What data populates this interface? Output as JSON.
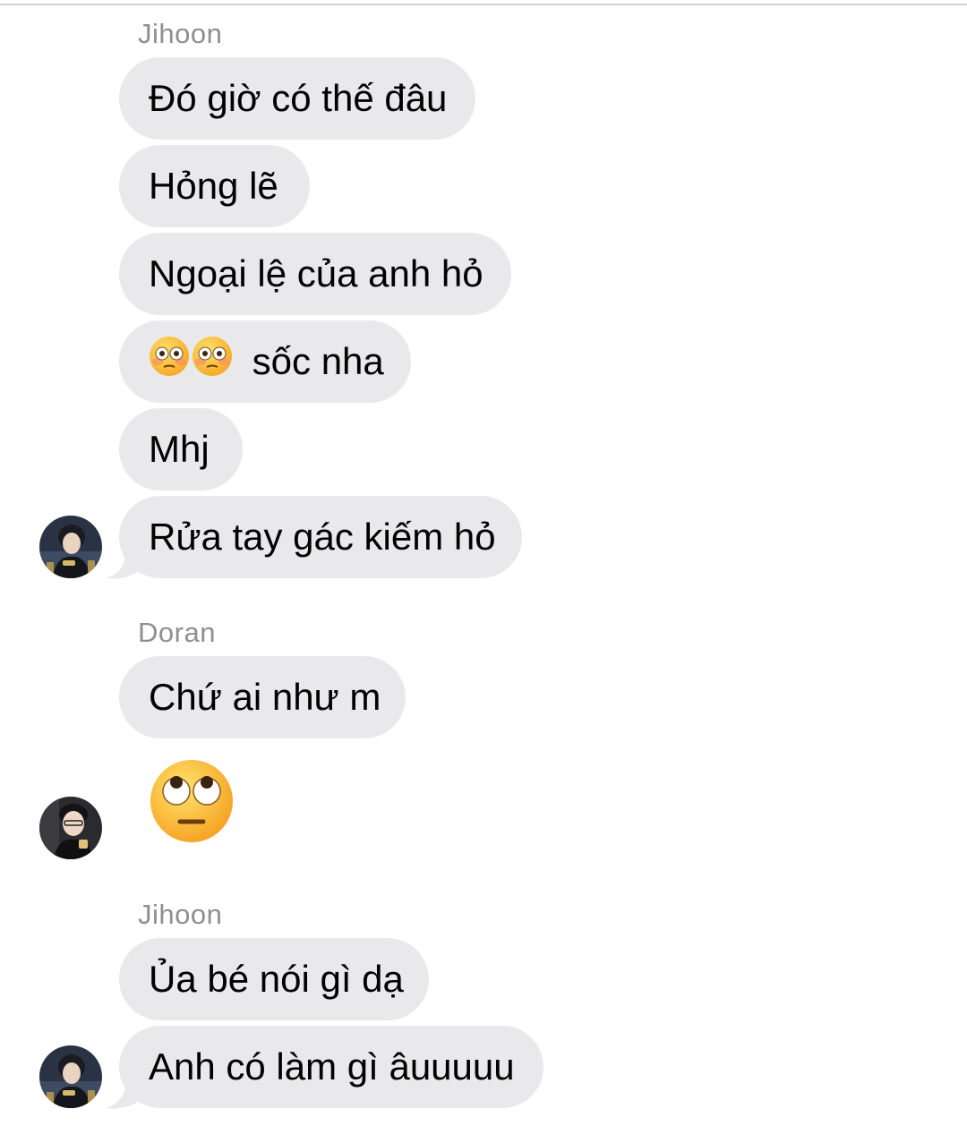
{
  "groups": [
    {
      "sender": "Jihoon",
      "messages": [
        "Đó giờ có thế đâu",
        "Hỏng lẽ",
        "Ngoại lệ của anh hỏ",
        "sốc nha",
        "Mhj",
        "Rửa tay gác kiếm hỏ"
      ]
    },
    {
      "sender": "Doran",
      "messages": [
        "Chứ ai như m"
      ],
      "emoji_message": "face-with-rolling-eyes"
    },
    {
      "sender": "Jihoon",
      "messages": [
        "Ủa bé nói gì dạ",
        "Anh có làm gì âuuuuu"
      ]
    }
  ],
  "emoji_prefix": [
    "flushed-face",
    "flushed-face"
  ],
  "colors": {
    "bubble": "#e9e9eb",
    "sender_name": "#8e8e93",
    "text": "#000000"
  }
}
